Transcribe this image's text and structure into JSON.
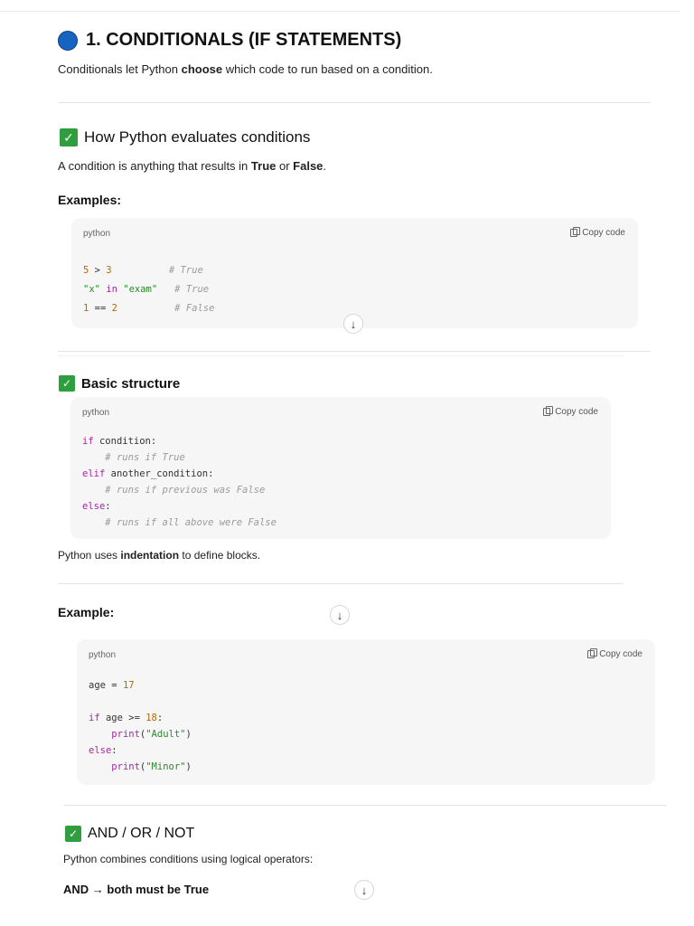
{
  "section1": {
    "title": "1. CONDITIONALS (IF STATEMENTS)",
    "intro_pre": "Conditionals let Python ",
    "intro_bold": "choose",
    "intro_post": " which code to run based on a condition."
  },
  "evaluates": {
    "heading": "How Python evaluates conditions",
    "desc_pre": "A condition is anything that results in ",
    "desc_true": "True",
    "desc_or": " or ",
    "desc_false": "False",
    "desc_end": ".",
    "examples_label": "Examples:",
    "code": {
      "lang": "python",
      "copy": "Copy code",
      "lines": [
        {
          "a": "5",
          "op": " > ",
          "b": "3",
          "pad": "          ",
          "comment": "# True"
        },
        {
          "a": "\"x\"",
          "op": " in ",
          "b": "\"exam\"",
          "pad": "   ",
          "comment": "# True"
        },
        {
          "a": "1",
          "op": " == ",
          "b": "2",
          "pad": "          ",
          "comment": "# False"
        }
      ]
    }
  },
  "basic": {
    "heading": "Basic structure",
    "code": {
      "lang": "python",
      "copy": "Copy code",
      "kw_if": "if",
      "cond1": " condition:",
      "cmt1": "# runs if True",
      "kw_elif": "elif",
      "cond2": " another_condition:",
      "cmt2": "# runs if previous was False",
      "kw_else": "else",
      "colon": ":",
      "cmt3": "# runs if all above were False"
    },
    "note_pre": "Python uses ",
    "note_bold": "indentation",
    "note_post": " to define blocks."
  },
  "example": {
    "label": "Example:",
    "code": {
      "lang": "python",
      "copy": "Copy code",
      "var": "age",
      "eq": " = ",
      "val": "17",
      "kw_if": "if",
      "cond": " age >= ",
      "cond_val": "18",
      "colon": ":",
      "fn": "print",
      "arg1": "\"Adult\"",
      "kw_else": "else",
      "arg2": "\"Minor\""
    }
  },
  "logic": {
    "heading": "AND / OR / NOT",
    "desc": "Python combines conditions using logical operators:",
    "and_label": "AND → both must be True"
  },
  "icons": {
    "scroll": "↓",
    "check": "✓"
  },
  "colors": {
    "accent_blue": "#1565c0",
    "check_green": "#2e9e3e",
    "code_bg": "#f6f6f6"
  }
}
